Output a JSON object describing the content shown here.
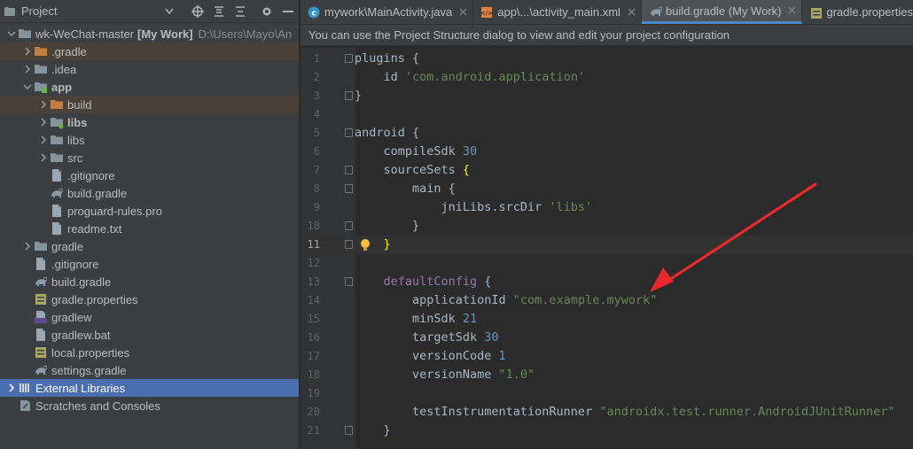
{
  "project_panel": {
    "title": "Project",
    "tree": [
      {
        "label": "wk-WeChat-master",
        "extra": "[My Work]",
        "path": "D:\\Users\\Mayo\\An",
        "arrow": "v",
        "icon": "folder",
        "indent": 0,
        "bold": false
      },
      {
        "label": ".gradle",
        "arrow": ">",
        "icon": "folder-orange",
        "indent": 1,
        "hl": "orange"
      },
      {
        "label": ".idea",
        "arrow": ">",
        "icon": "folder",
        "indent": 1
      },
      {
        "label": "app",
        "arrow": "v",
        "icon": "folder-module",
        "indent": 1,
        "bold": true
      },
      {
        "label": "build",
        "arrow": ">",
        "icon": "folder-orange",
        "indent": 2,
        "hl": "orange"
      },
      {
        "label": "libs",
        "arrow": ">",
        "icon": "folder-dot",
        "indent": 2,
        "bold": true
      },
      {
        "label": "libs",
        "arrow": ">",
        "icon": "folder",
        "indent": 2
      },
      {
        "label": "src",
        "arrow": ">",
        "icon": "folder",
        "indent": 2
      },
      {
        "label": ".gitignore",
        "arrow": "",
        "icon": "file",
        "indent": 2
      },
      {
        "label": "build.gradle",
        "arrow": "",
        "icon": "gradle",
        "indent": 2
      },
      {
        "label": "proguard-rules.pro",
        "arrow": "",
        "icon": "file",
        "indent": 2
      },
      {
        "label": "readme.txt",
        "arrow": "",
        "icon": "file",
        "indent": 2
      },
      {
        "label": "gradle",
        "arrow": ">",
        "icon": "folder",
        "indent": 1
      },
      {
        "label": ".gitignore",
        "arrow": "",
        "icon": "file",
        "indent": 1
      },
      {
        "label": "build.gradle",
        "arrow": "",
        "icon": "gradle",
        "indent": 1
      },
      {
        "label": "gradle.properties",
        "arrow": "",
        "icon": "props",
        "indent": 1
      },
      {
        "label": "gradlew",
        "arrow": "",
        "icon": "file-exec",
        "indent": 1
      },
      {
        "label": "gradlew.bat",
        "arrow": "",
        "icon": "file",
        "indent": 1
      },
      {
        "label": "local.properties",
        "arrow": "",
        "icon": "props",
        "indent": 1
      },
      {
        "label": "settings.gradle",
        "arrow": "",
        "icon": "gradle",
        "indent": 1
      },
      {
        "label": "External Libraries",
        "arrow": ">",
        "icon": "libraries",
        "indent": 0,
        "hl": "blue"
      },
      {
        "label": "Scratches and Consoles",
        "arrow": "",
        "icon": "scratches",
        "indent": 0
      }
    ]
  },
  "tabs": [
    {
      "label": "mywork\\MainActivity.java",
      "icon": "class",
      "active": false
    },
    {
      "label": "app\\...\\activity_main.xml",
      "icon": "xml",
      "active": false
    },
    {
      "label": "build.gradle (My Work)",
      "icon": "gradle",
      "active": true
    },
    {
      "label": "gradle.properties",
      "icon": "props",
      "active": false
    }
  ],
  "notice": "You can use the Project Structure dialog to view and edit your project configuration",
  "code_lines": [
    {
      "n": "1",
      "indent": 0,
      "parts": [
        [
          "plain",
          "plugins {"
        ]
      ],
      "fold": true
    },
    {
      "n": "2",
      "indent": 1,
      "parts": [
        [
          "plain",
          "id "
        ],
        [
          "str",
          "'com.android.application'"
        ]
      ]
    },
    {
      "n": "3",
      "indent": 0,
      "parts": [
        [
          "plain",
          "}"
        ]
      ],
      "fold": true
    },
    {
      "n": "4",
      "indent": 0,
      "parts": []
    },
    {
      "n": "5",
      "indent": 0,
      "parts": [
        [
          "plain",
          "android {"
        ]
      ],
      "fold": true
    },
    {
      "n": "6",
      "indent": 1,
      "parts": [
        [
          "plain",
          "compileSdk "
        ],
        [
          "num",
          "30"
        ]
      ]
    },
    {
      "n": "7",
      "indent": 1,
      "parts": [
        [
          "plain",
          "sourceSets "
        ],
        [
          "brk2",
          "{"
        ]
      ],
      "fold": true
    },
    {
      "n": "8",
      "indent": 2,
      "parts": [
        [
          "plain",
          "main {"
        ]
      ],
      "fold": true
    },
    {
      "n": "9",
      "indent": 3,
      "parts": [
        [
          "plain",
          "jniLibs.srcDir "
        ],
        [
          "str",
          "'libs'"
        ]
      ]
    },
    {
      "n": "10",
      "indent": 2,
      "parts": [
        [
          "plain",
          "}"
        ]
      ],
      "fold": true
    },
    {
      "n": "11",
      "indent": 1,
      "parts": [
        [
          "brk2",
          "}"
        ]
      ],
      "fold": true,
      "current": true,
      "bulb": true
    },
    {
      "n": "12",
      "indent": 0,
      "parts": []
    },
    {
      "n": "13",
      "indent": 1,
      "parts": [
        [
          "fn",
          "defaultConfig"
        ],
        [
          "plain",
          " {"
        ]
      ],
      "fold": true
    },
    {
      "n": "14",
      "indent": 2,
      "parts": [
        [
          "plain",
          "applicationId "
        ],
        [
          "str",
          "\"com.example.mywork\""
        ]
      ]
    },
    {
      "n": "15",
      "indent": 2,
      "parts": [
        [
          "plain",
          "minSdk "
        ],
        [
          "num",
          "21"
        ]
      ]
    },
    {
      "n": "16",
      "indent": 2,
      "parts": [
        [
          "plain",
          "targetSdk "
        ],
        [
          "num",
          "30"
        ]
      ]
    },
    {
      "n": "17",
      "indent": 2,
      "parts": [
        [
          "plain",
          "versionCode "
        ],
        [
          "num",
          "1"
        ]
      ]
    },
    {
      "n": "18",
      "indent": 2,
      "parts": [
        [
          "plain",
          "versionName "
        ],
        [
          "str",
          "\"1.0\""
        ]
      ]
    },
    {
      "n": "19",
      "indent": 0,
      "parts": []
    },
    {
      "n": "20",
      "indent": 2,
      "parts": [
        [
          "plain",
          "testInstrumentationRunner "
        ],
        [
          "str",
          "\"androidx.test.runner.AndroidJUnitRunner\""
        ]
      ]
    },
    {
      "n": "21",
      "indent": 1,
      "parts": [
        [
          "plain",
          "}"
        ]
      ],
      "fold": true
    }
  ],
  "colors": {
    "editor_bg": "#2b2b2b",
    "panel_bg": "#3c3f41",
    "selection_blue": "#4b6eaf",
    "string": "#6a8759",
    "number": "#6897bb",
    "keyword_purple": "#9876aa",
    "annotation_arrow": "#e8292b"
  }
}
